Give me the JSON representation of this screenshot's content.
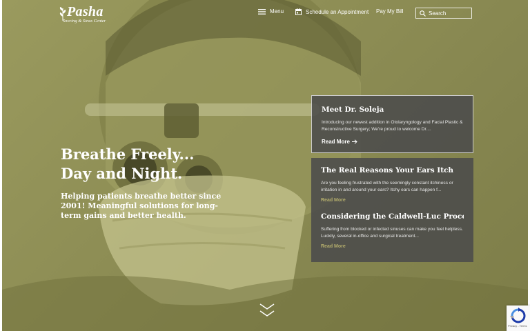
{
  "logo": {
    "name": "Pasha",
    "tagline": "Snoring & Sinus Center"
  },
  "nav": {
    "menu_label": "Menu",
    "appointment_label": "Schedule an Appointment",
    "pay_label": "Pay My Bill",
    "search_placeholder": "Search"
  },
  "hero": {
    "headline_line1": "Breathe Freely...",
    "headline_line2": "Day and Night.",
    "subtext": "Helping patients breathe better since 2001! Meaningful solutions for long-term gains and better health."
  },
  "featured": {
    "title": "Meet Dr. Soleja",
    "excerpt": "Introducing our newest addition in Otolaryngology and Facial Plastic & Reconstructive Surgery; We're proud to welcome Dr....",
    "link": "Read More"
  },
  "articles": [
    {
      "title": "The Real Reasons Your Ears Itch",
      "excerpt": "Are you feeling frustrated with the seemingly constant itchiness or irritation in and around your ears? Itchy ears can happen f...",
      "link": "Read More"
    },
    {
      "title": "Considering the Caldwell-Luc Procedure...",
      "excerpt": "Suffering from blocked or infected sinuses can make you feel helpless. Luckily, several in-office and surgical treatment...",
      "link": "Read More"
    }
  ],
  "recaptcha": {
    "links": "Privacy - Terms"
  },
  "colors": {
    "overlay": "#8e8e55",
    "card": "#4b4b4b",
    "accent": "#b3ad6c"
  }
}
